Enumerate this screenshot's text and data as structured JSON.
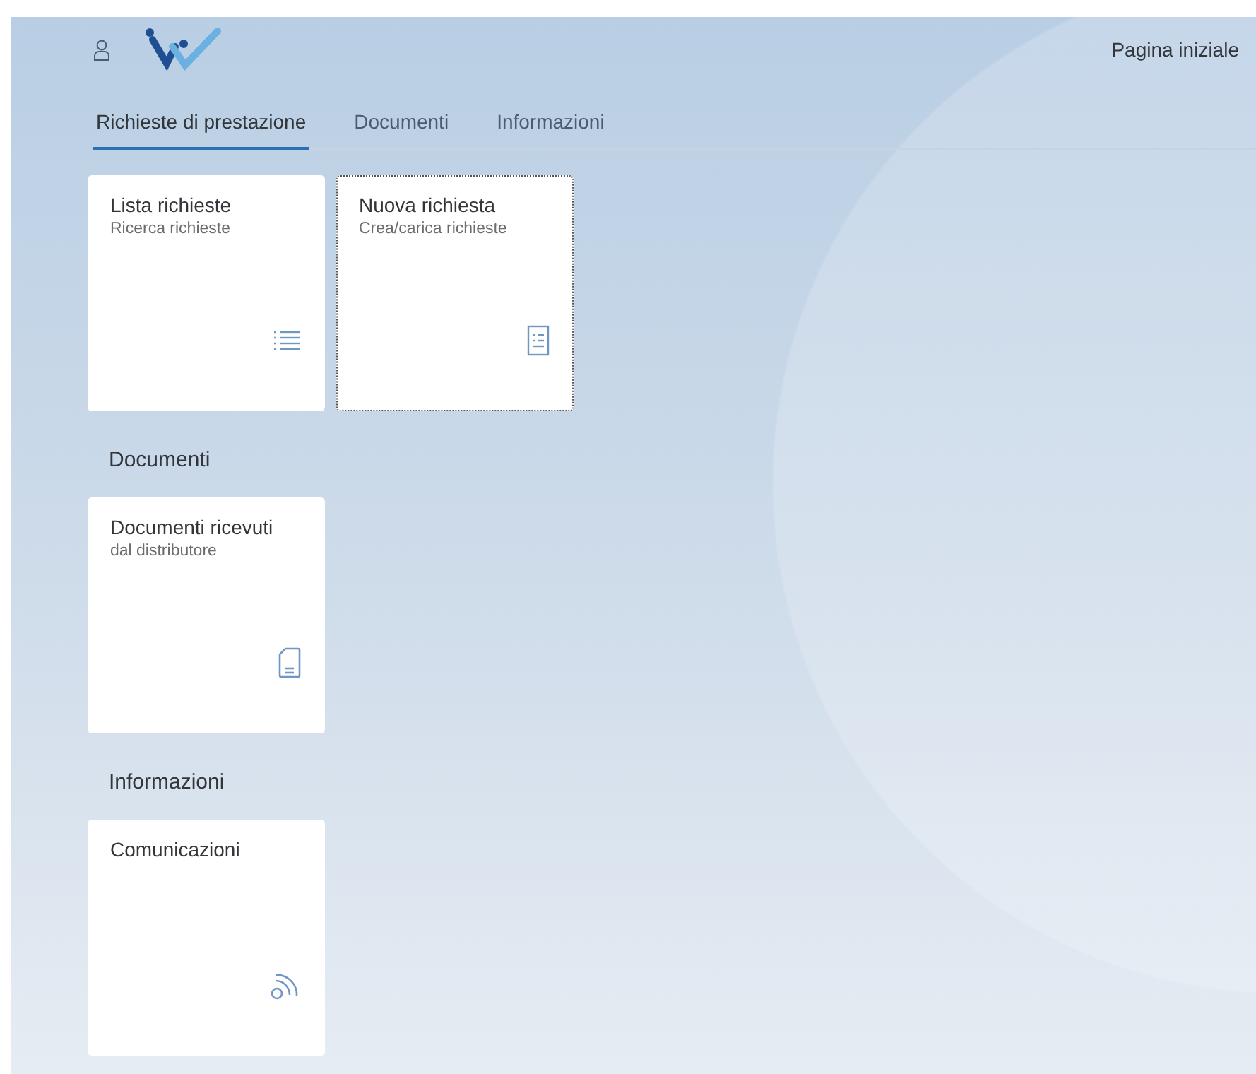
{
  "header": {
    "title": "Pagina iniziale"
  },
  "tabs": [
    {
      "label": "Richieste di prestazione",
      "selected": true
    },
    {
      "label": "Documenti",
      "selected": false
    },
    {
      "label": "Informazioni",
      "selected": false
    }
  ],
  "sections": [
    {
      "tiles": [
        {
          "title": "Lista richieste",
          "subtitle": "Ricerca richieste",
          "kind": "list",
          "focused": false
        },
        {
          "title": "Nuova richiesta",
          "subtitle": "Crea/carica richieste",
          "kind": "form",
          "focused": true
        }
      ]
    },
    {
      "heading": "Documenti",
      "tiles": [
        {
          "title": "Documenti ricevuti",
          "subtitle": "dal distributore",
          "kind": "document",
          "focused": false
        }
      ]
    },
    {
      "heading": "Informazioni",
      "tiles": [
        {
          "title": "Comunicazioni",
          "kind": "feed",
          "focused": false
        }
      ]
    }
  ]
}
